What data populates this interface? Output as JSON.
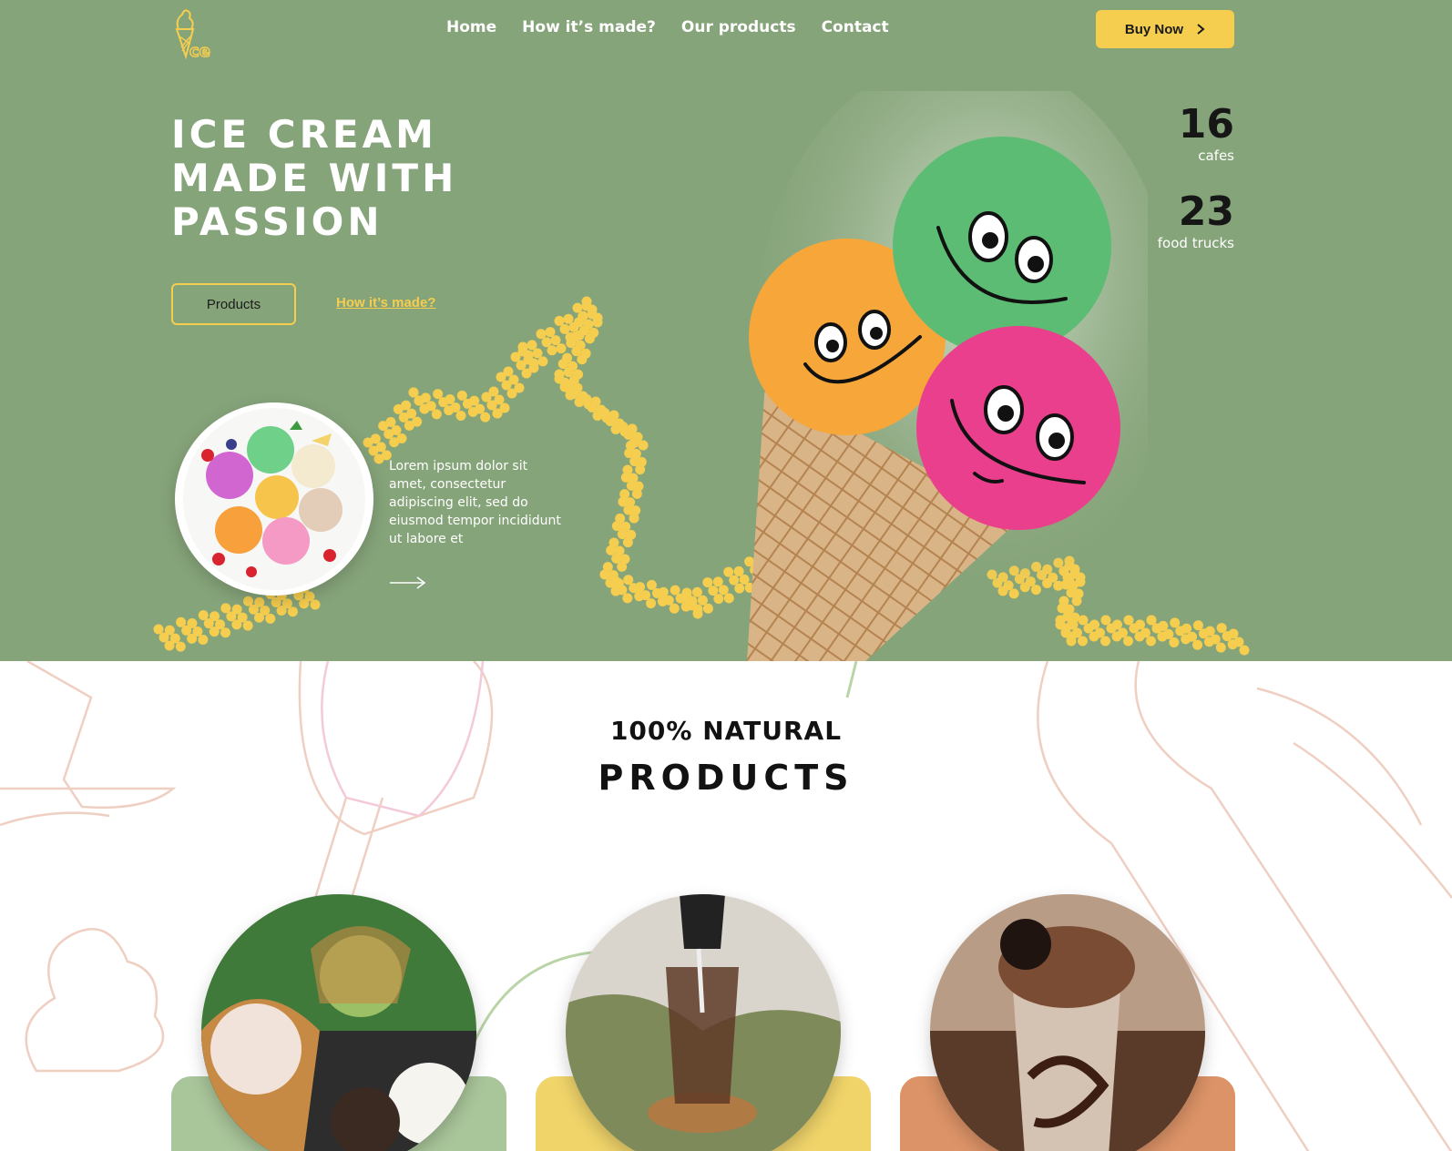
{
  "header": {
    "logo_icon": "ice-cream-logo-icon",
    "nav": [
      "Home",
      "How it’s made?",
      "Our products",
      "Contact"
    ],
    "buy_label": "Buy Now"
  },
  "hero": {
    "headline": [
      "ICE CREAM",
      "MADE WITH",
      "PASSION"
    ],
    "primary_button": "Products",
    "secondary_link": "How it’s made?",
    "description": "Lorem ipsum dolor sit amet, consectetur adipiscing elit, sed do eiusmod tempor incididunt ut labore et",
    "stats": [
      {
        "value": "16",
        "label": "cafes"
      },
      {
        "value": "23",
        "label": "food trucks"
      }
    ]
  },
  "products_section": {
    "subtitle": "100% NATURAL",
    "title": "PRODUCTS"
  },
  "colors": {
    "hero_bg": "#86a47a",
    "accent": "#f5cd4f",
    "card_green": "#a9c59a",
    "card_yellow": "#f0d46a",
    "card_orange": "#dc9367"
  }
}
